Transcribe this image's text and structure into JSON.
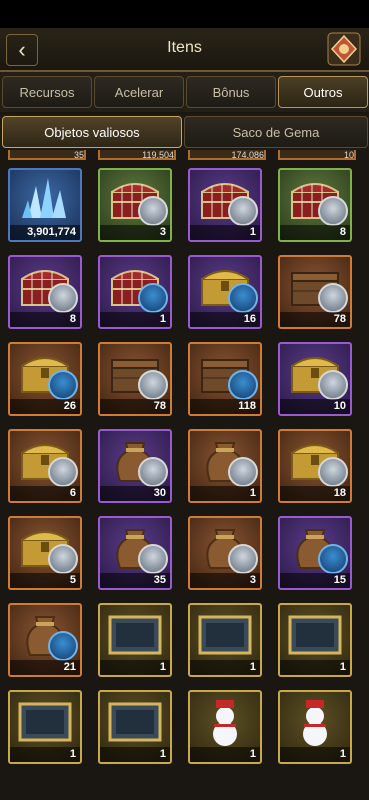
{
  "header": {
    "title": "Itens"
  },
  "tabs": [
    "Recursos",
    "Acelerar",
    "Bônus",
    "Outros"
  ],
  "subtabs": [
    "Objetos valiosos",
    "Saco de Gema"
  ],
  "partial_counts": [
    "35",
    "119,504",
    "174,086",
    "10"
  ],
  "items": [
    {
      "type": "crystal",
      "bg": "blue",
      "count": "3,901,774"
    },
    {
      "type": "chest-red",
      "bg": "green",
      "count": "3",
      "badge": "helm"
    },
    {
      "type": "chest-red",
      "bg": "purple",
      "count": "1",
      "badge": "helm"
    },
    {
      "type": "chest-red",
      "bg": "green",
      "count": "8",
      "badge": "helm"
    },
    {
      "type": "chest-red",
      "bg": "purple",
      "count": "8",
      "badge": "helm"
    },
    {
      "type": "chest-red",
      "bg": "purple",
      "count": "1",
      "badge": "hood"
    },
    {
      "type": "chest-gold",
      "bg": "purple",
      "count": "16",
      "badge": "hood"
    },
    {
      "type": "chest-wood",
      "bg": "orange",
      "count": "78",
      "badge": "helm"
    },
    {
      "type": "chest-gold",
      "bg": "orange",
      "count": "26",
      "badge": "hood"
    },
    {
      "type": "chest-wood",
      "bg": "orange",
      "count": "78",
      "badge": "helm"
    },
    {
      "type": "chest-wood",
      "bg": "orange",
      "count": "118",
      "badge": "hood"
    },
    {
      "type": "chest-gold",
      "bg": "purple",
      "count": "10",
      "badge": "helm"
    },
    {
      "type": "chest-gold",
      "bg": "orange",
      "count": "6",
      "badge": "helm"
    },
    {
      "type": "sack",
      "bg": "purple",
      "count": "30",
      "badge": "helm"
    },
    {
      "type": "sack",
      "bg": "orange",
      "count": "1",
      "badge": "helm"
    },
    {
      "type": "chest-gold",
      "bg": "orange",
      "count": "18",
      "badge": "helm"
    },
    {
      "type": "chest-gold",
      "bg": "orange",
      "count": "5",
      "badge": "helm"
    },
    {
      "type": "sack",
      "bg": "purple",
      "count": "35",
      "badge": "helm"
    },
    {
      "type": "sack",
      "bg": "orange",
      "count": "3",
      "badge": "helm"
    },
    {
      "type": "sack",
      "bg": "purple",
      "count": "15",
      "badge": "hood"
    },
    {
      "type": "sack",
      "bg": "orange",
      "count": "21",
      "badge": "hood"
    },
    {
      "type": "frame",
      "bg": "gold",
      "count": "1"
    },
    {
      "type": "frame",
      "bg": "gold",
      "count": "1"
    },
    {
      "type": "frame",
      "bg": "gold",
      "count": "1"
    },
    {
      "type": "frame",
      "bg": "gold",
      "count": "1"
    },
    {
      "type": "frame",
      "bg": "gold",
      "count": "1"
    },
    {
      "type": "snowman",
      "bg": "gold",
      "count": "1"
    },
    {
      "type": "snowman",
      "bg": "gold",
      "count": "1"
    }
  ]
}
